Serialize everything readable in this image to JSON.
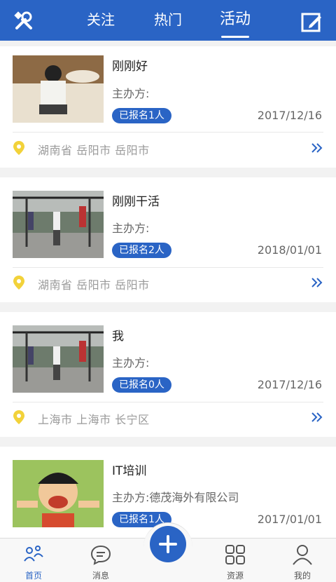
{
  "header": {
    "tabs": [
      {
        "label": "关注",
        "active": false
      },
      {
        "label": "热门",
        "active": false
      },
      {
        "label": "活动",
        "active": true
      }
    ],
    "left_icon": "tools-icon",
    "right_icon": "edit-icon",
    "bg_color": "#2a64c5"
  },
  "activities": [
    {
      "title": "刚刚好",
      "organizer": "主办方:",
      "badge": "已报名1人",
      "date": "2017/12/16",
      "location": "湖南省 岳阳市 岳阳市"
    },
    {
      "title": "刚刚干活",
      "organizer": "主办方:",
      "badge": "已报名2人",
      "date": "2018/01/01",
      "location": "湖南省 岳阳市 岳阳市"
    },
    {
      "title": "我",
      "organizer": "主办方:",
      "badge": "已报名0人",
      "date": "2017/12/16",
      "location": "上海市 上海市 长宁区"
    },
    {
      "title": "IT培训",
      "organizer": "主办方:德茂海外有限公司",
      "badge": "已报名1人",
      "date": "2017/01/01"
    }
  ],
  "bottom_nav": [
    {
      "label": "首页",
      "icon": "home-icon",
      "active": true
    },
    {
      "label": "消息",
      "icon": "message-icon",
      "active": false
    },
    {
      "label": "",
      "icon": "plus-icon",
      "active": false
    },
    {
      "label": "资源",
      "icon": "grid-icon",
      "active": false
    },
    {
      "label": "我的",
      "icon": "profile-icon",
      "active": false
    }
  ],
  "colors": {
    "accent": "#2a64c5",
    "pin": "#f2d23a"
  }
}
